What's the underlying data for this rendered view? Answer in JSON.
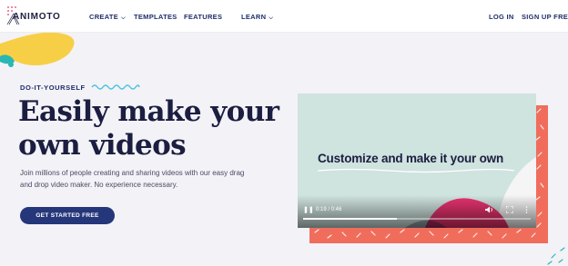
{
  "brand": {
    "name": "ANIMOTO"
  },
  "nav": {
    "items": [
      {
        "label": "CREATE",
        "has_dropdown": true
      },
      {
        "label": "TEMPLATES",
        "has_dropdown": false
      },
      {
        "label": "FEATURES",
        "has_dropdown": false
      },
      {
        "label": "LEARN",
        "has_dropdown": true
      }
    ],
    "login_label": "LOG IN",
    "signup_label": "SIGN UP FREE"
  },
  "hero": {
    "eyebrow": "DO-IT-YOURSELF",
    "headline_line1": "Easily make your",
    "headline_line2": "own videos",
    "subcopy_line1": "Join millions of people creating and sharing videos with our easy drag",
    "subcopy_line2": "and drop video maker. No experience necessary.",
    "cta_label": "GET STARTED FREE"
  },
  "video": {
    "caption": "Customize and make it your own",
    "time": "0:19 / 0:46",
    "progress_fraction": 0.41
  },
  "colors": {
    "navy": "#1b1e40",
    "nav_text": "#1f2d6b",
    "cta_bg": "#25367a",
    "coral": "#f06d5c",
    "mint": "#cfe3df",
    "wave": "#4cc3e0",
    "yellow": "#f7cf46",
    "teal": "#2ab7b3",
    "pink": "#e8336f"
  },
  "icons": {
    "logo": "animoto-logo-icon",
    "dropdown": "chevron-down-icon",
    "play": "play-pause-icon",
    "volume": "volume-icon",
    "fullscreen": "fullscreen-icon",
    "more": "more-options-icon"
  }
}
